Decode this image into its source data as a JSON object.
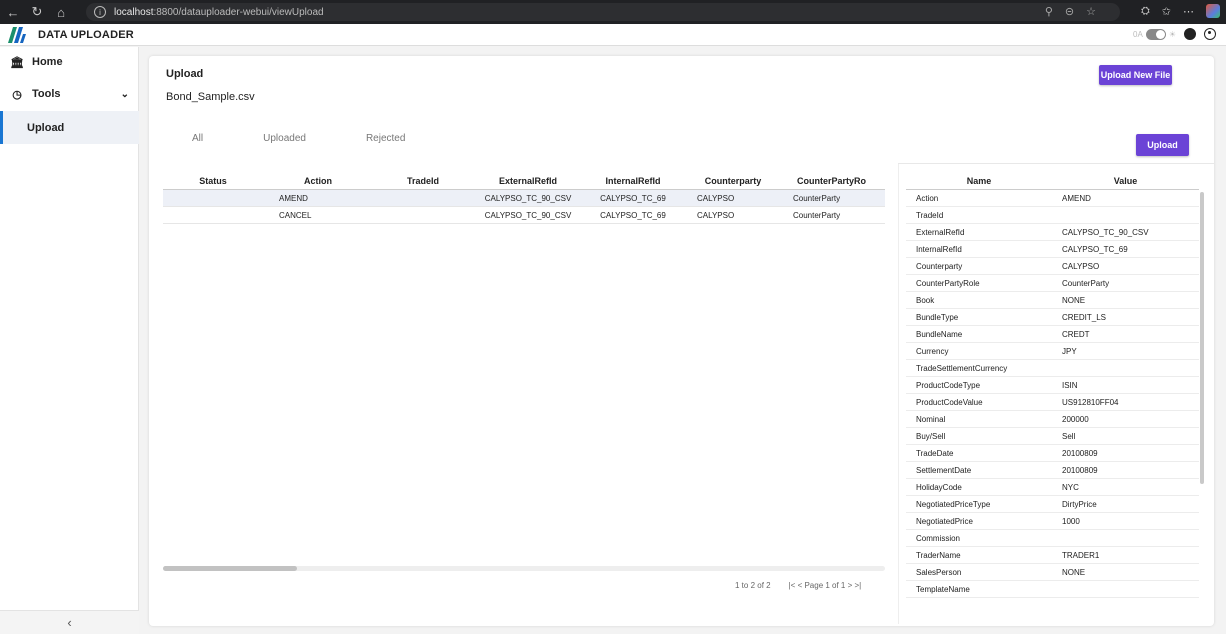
{
  "browser": {
    "url_host": "localhost",
    "url_rest": ":8800/datauploader-webui/viewUpload"
  },
  "app": {
    "title": "DATA UPLOADER",
    "toggle_label": "0A"
  },
  "sidebar": {
    "items": [
      {
        "label": "Home",
        "icon": "bank-icon"
      },
      {
        "label": "Tools",
        "icon": "tools-icon"
      },
      {
        "label": "Upload"
      }
    ]
  },
  "main": {
    "title": "Upload",
    "file_name": "Bond_Sample.csv",
    "upload_new_file_label": "Upload New File",
    "upload_label": "Upload",
    "tabs": [
      "All",
      "Uploaded",
      "Rejected"
    ],
    "columns": [
      "Status",
      "Action",
      "TradeId",
      "ExternalRefId",
      "InternalRefId",
      "Counterparty",
      "CounterPartyRo"
    ],
    "rows": [
      [
        "",
        "AMEND",
        "",
        "CALYPSO_TC_90_CSV",
        "CALYPSO_TC_69",
        "CALYPSO",
        "CounterParty"
      ],
      [
        "",
        "CANCEL",
        "",
        "CALYPSO_TC_90_CSV",
        "CALYPSO_TC_69",
        "CALYPSO",
        "CounterParty"
      ]
    ],
    "pager": {
      "range": "1 to 2 of 2",
      "nav": "|< < Page 1 of 1 > >|"
    }
  },
  "detail": {
    "columns": [
      "Name",
      "Value"
    ],
    "rows": [
      [
        "Action",
        "AMEND"
      ],
      [
        "TradeId",
        ""
      ],
      [
        "ExternalRefId",
        "CALYPSO_TC_90_CSV"
      ],
      [
        "InternalRefId",
        "CALYPSO_TC_69"
      ],
      [
        "Counterparty",
        "CALYPSO"
      ],
      [
        "CounterPartyRole",
        "CounterParty"
      ],
      [
        "Book",
        "NONE"
      ],
      [
        "BundleType",
        "CREDIT_LS"
      ],
      [
        "BundleName",
        "CREDT"
      ],
      [
        "Currency",
        "JPY"
      ],
      [
        "TradeSettlementCurrency",
        ""
      ],
      [
        "ProductCodeType",
        "ISIN"
      ],
      [
        "ProductCodeValue",
        "US912810FF04"
      ],
      [
        "Nominal",
        "200000"
      ],
      [
        "Buy/Sell",
        "Sell"
      ],
      [
        "TradeDate",
        "20100809"
      ],
      [
        "SettlementDate",
        "20100809"
      ],
      [
        "HolidayCode",
        "NYC"
      ],
      [
        "NegotiatedPriceType",
        "DirtyPrice"
      ],
      [
        "NegotiatedPrice",
        "1000"
      ],
      [
        "Commission",
        ""
      ],
      [
        "TraderName",
        "TRADER1"
      ],
      [
        "SalesPerson",
        "NONE"
      ],
      [
        "TemplateName",
        ""
      ]
    ]
  }
}
